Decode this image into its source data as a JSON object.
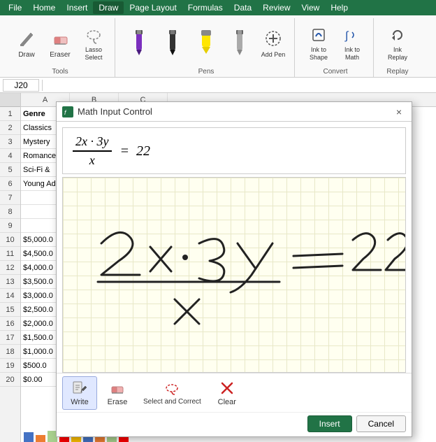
{
  "menubar": {
    "items": [
      "File",
      "Home",
      "Insert",
      "Draw",
      "Page Layout",
      "Formulas",
      "Data",
      "Review",
      "View",
      "Help"
    ]
  },
  "ribbon": {
    "active_tab": "Draw",
    "groups": [
      {
        "label": "Tools",
        "buttons": [
          {
            "label": "Draw",
            "icon": "draw-icon"
          },
          {
            "label": "Eraser",
            "icon": "eraser-icon"
          },
          {
            "label": "Lasso Select",
            "icon": "lasso-icon"
          }
        ]
      },
      {
        "label": "Pens",
        "buttons": [
          {
            "label": "",
            "icon": "pen-purple-icon"
          },
          {
            "label": "",
            "icon": "pen-black-icon"
          },
          {
            "label": "",
            "icon": "pen-yellow-icon"
          },
          {
            "label": "",
            "icon": "pen-gray-icon"
          },
          {
            "label": "Add Pen",
            "icon": "add-pen-icon"
          }
        ]
      },
      {
        "label": "Convert",
        "buttons": [
          {
            "label": "Ink to Shape",
            "icon": "ink-shape-icon"
          },
          {
            "label": "Ink to Math",
            "icon": "ink-math-icon"
          }
        ]
      },
      {
        "label": "Replay",
        "buttons": [
          {
            "label": "Ink Replay",
            "icon": "ink-replay-icon"
          }
        ]
      }
    ]
  },
  "formula_bar": {
    "cell_ref": "J20"
  },
  "spreadsheet": {
    "rows": [
      {
        "num": "1",
        "cells": [
          "Genre"
        ]
      },
      {
        "num": "2",
        "cells": [
          "Classics"
        ]
      },
      {
        "num": "3",
        "cells": [
          "Mystery"
        ]
      },
      {
        "num": "4",
        "cells": [
          "Romance"
        ]
      },
      {
        "num": "5",
        "cells": [
          "Sci-Fi &"
        ]
      },
      {
        "num": "6",
        "cells": [
          "Young Ad"
        ]
      },
      {
        "num": "7",
        "cells": []
      },
      {
        "num": "8",
        "cells": []
      },
      {
        "num": "9",
        "cells": []
      },
      {
        "num": "10",
        "cells": [
          "$5,000.0"
        ]
      },
      {
        "num": "11",
        "cells": [
          "$4,500.0"
        ]
      },
      {
        "num": "12",
        "cells": [
          "$4,000.0"
        ]
      },
      {
        "num": "13",
        "cells": [
          "$3,500.0"
        ]
      },
      {
        "num": "14",
        "cells": [
          "$3,000.0"
        ]
      },
      {
        "num": "15",
        "cells": [
          "$2,500.0"
        ]
      },
      {
        "num": "16",
        "cells": [
          "$2,000.0"
        ]
      },
      {
        "num": "17",
        "cells": [
          "$1,500.0"
        ]
      },
      {
        "num": "18",
        "cells": [
          "$1,000.0"
        ]
      },
      {
        "num": "19",
        "cells": [
          "$500.0"
        ]
      },
      {
        "num": "20",
        "cells": [
          "$0.00"
        ]
      }
    ]
  },
  "dialog": {
    "title": "Math Input Control",
    "math_display": "2x · 3y / x = 22",
    "close_label": "×",
    "tools": [
      {
        "label": "Write",
        "icon": "write-icon",
        "active": true
      },
      {
        "label": "Erase",
        "icon": "erase-icon",
        "active": false
      },
      {
        "label": "Select and Correct",
        "icon": "select-correct-icon",
        "active": false
      },
      {
        "label": "Clear",
        "icon": "clear-icon",
        "active": false
      }
    ],
    "actions": [
      {
        "label": "Insert",
        "primary": true
      },
      {
        "label": "Cancel",
        "primary": false
      }
    ]
  }
}
